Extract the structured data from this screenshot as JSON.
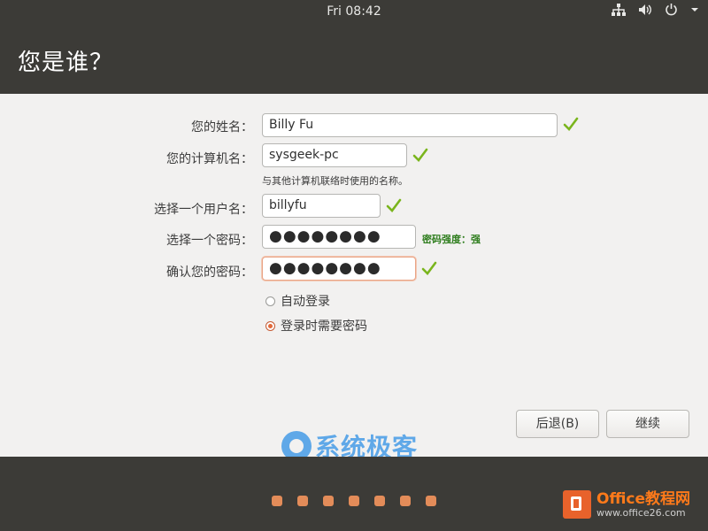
{
  "topbar": {
    "clock": "Fri 08:42"
  },
  "header": {
    "title": "您是谁？"
  },
  "form": {
    "name_label": "您的姓名：",
    "name_value": "Billy Fu",
    "computer_label": "您的计算机名：",
    "computer_value": "sysgeek-pc",
    "computer_hint": "与其他计算机联络时使用的名称。",
    "username_label": "选择一个用户名：",
    "username_value": "billyfu",
    "password_label": "选择一个密码：",
    "password_value": "●●●●●●●●",
    "password_strength": "密码强度：强",
    "confirm_label": "确认您的密码：",
    "confirm_value": "●●●●●●●●",
    "login_options": [
      {
        "label": "自动登录",
        "selected": false
      },
      {
        "label": "登录时需要密码",
        "selected": true
      }
    ]
  },
  "buttons": {
    "back": "后退(B)",
    "continue": "继续"
  },
  "watermark": {
    "text": "系统极客"
  },
  "badge": {
    "line1": "Office教程网",
    "line2": "www.office26.com"
  },
  "progress": {
    "steps": 7
  },
  "colors": {
    "accent": "#e38c59",
    "check": "#7ab51d",
    "strength": "#2e7d1d"
  }
}
